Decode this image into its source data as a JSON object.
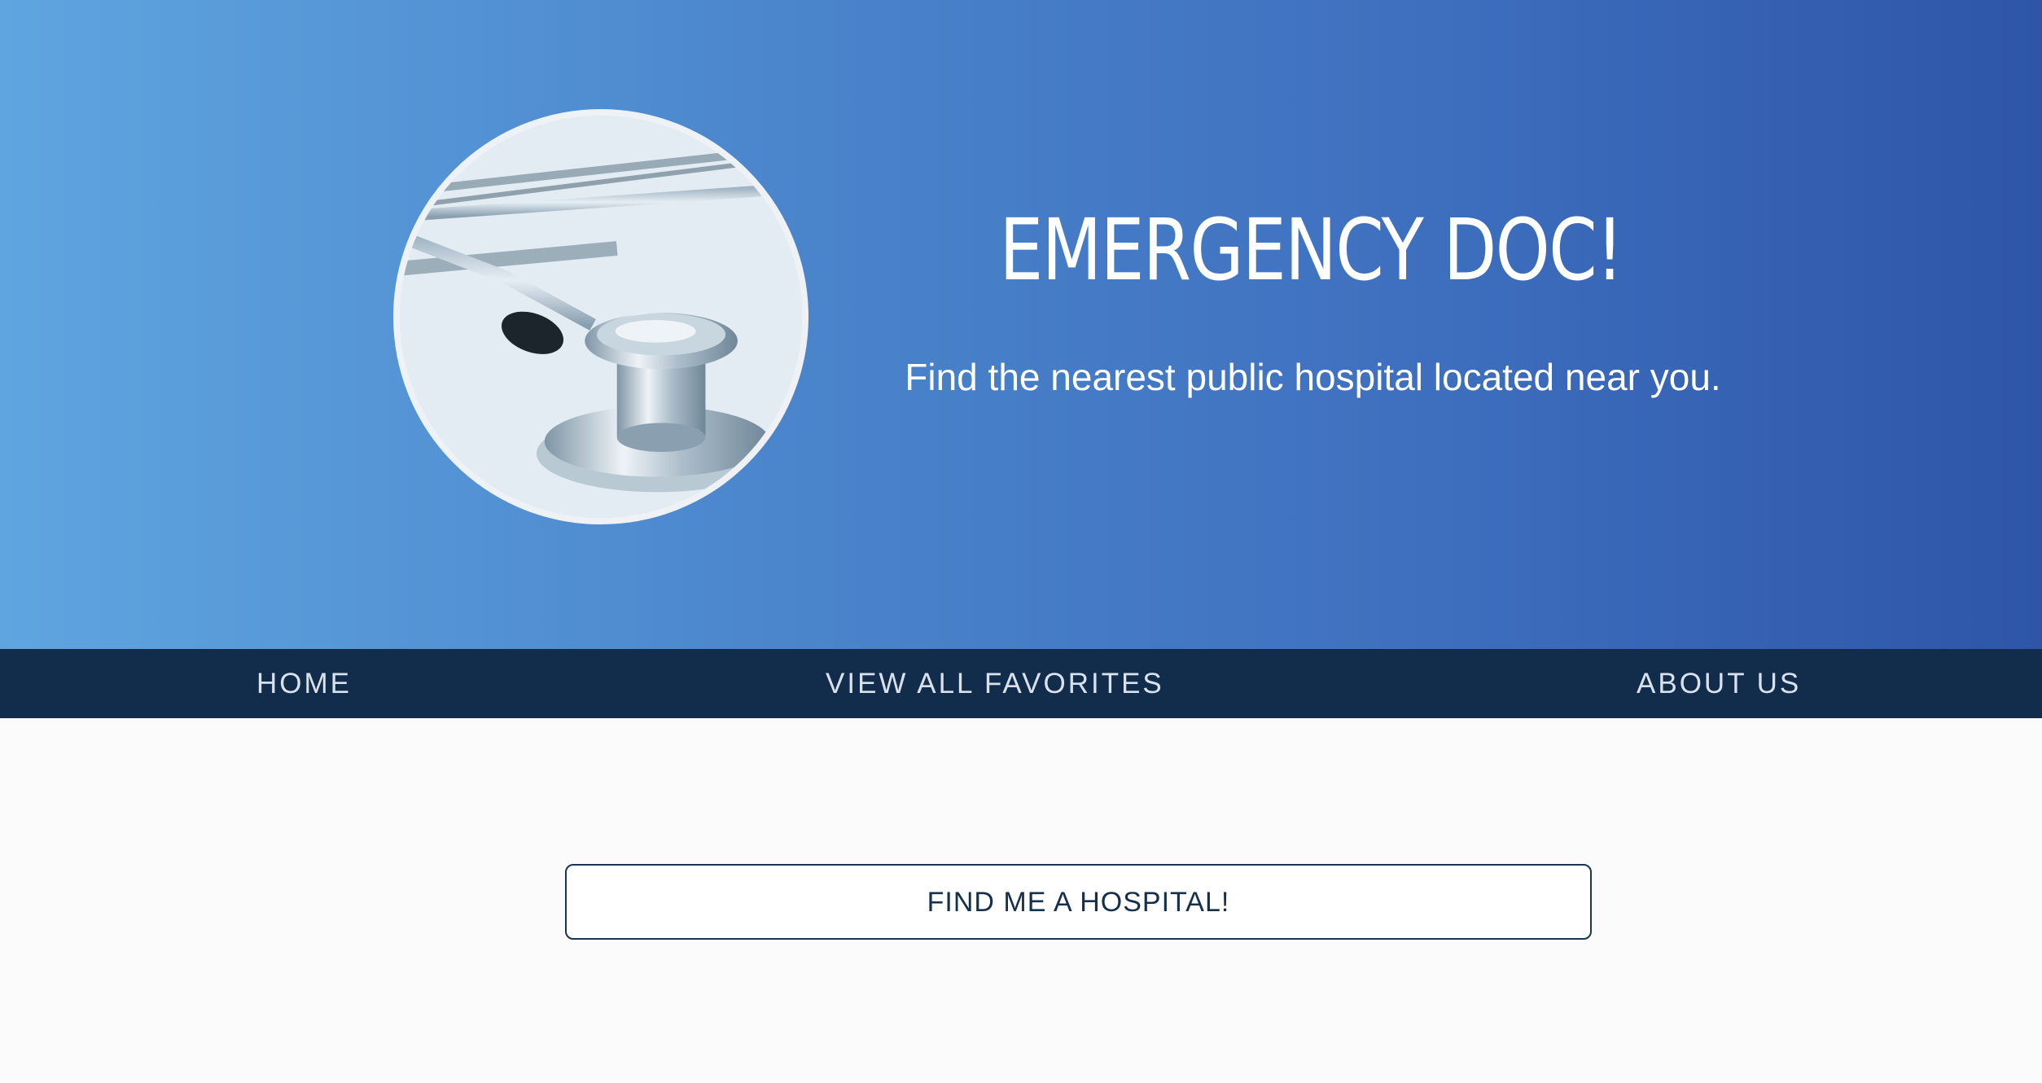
{
  "hero": {
    "title": "EMERGENCY DOC!",
    "subtitle": "Find the nearest public hospital located near you.",
    "image_icon": "stethoscope-icon"
  },
  "nav": {
    "items": [
      {
        "label": "HOME"
      },
      {
        "label": "VIEW ALL FAVORITES"
      },
      {
        "label": "ABOUT US"
      }
    ]
  },
  "main": {
    "cta_label": "FIND ME A HOSPITAL!"
  },
  "colors": {
    "hero_gradient_start": "#5fa5e0",
    "hero_gradient_end": "#2e55a8",
    "navbar": "#112d4b",
    "page_background": "#fbfbfb",
    "button_border": "#1b3550"
  }
}
